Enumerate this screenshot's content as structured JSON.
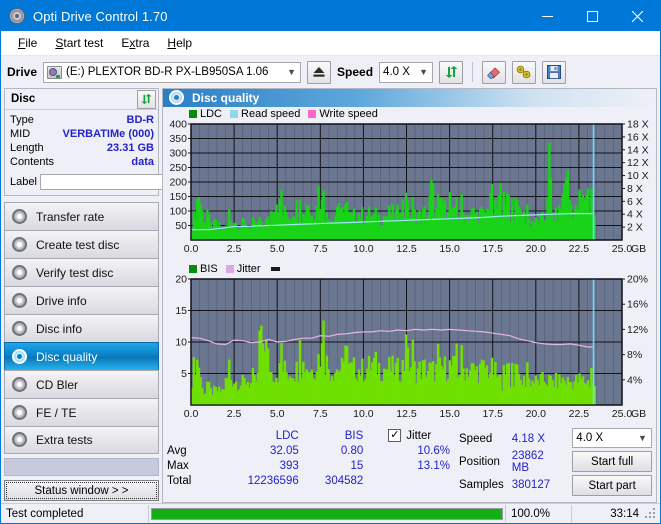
{
  "window": {
    "title": "Opti Drive Control 1.70",
    "icon": "disc-icon",
    "minimize": "minimize-icon",
    "maximize": "maximize-icon",
    "close": "close-icon"
  },
  "menu": [
    {
      "label": "File",
      "accel": "F"
    },
    {
      "label": "Start test",
      "accel": "S"
    },
    {
      "label": "Extra",
      "accel": "x"
    },
    {
      "label": "Help",
      "accel": "H"
    }
  ],
  "drivebar": {
    "drive_label": "Drive",
    "drive_value": "(E:)   PLEXTOR BD-R  PX-LB950SA 1.06",
    "eject_icon": "eject-icon",
    "speed_label": "Speed",
    "speed_value": "4.0 X",
    "refresh_icon": "refresh-icon",
    "erase_icon": "eraser-icon",
    "tools_icon": "plug-icon",
    "save_icon": "floppy-save-icon"
  },
  "disc_panel": {
    "title": "Disc",
    "refresh_icon": "refresh-icon",
    "rows": [
      {
        "key": "Type",
        "value": "BD-R"
      },
      {
        "key": "MID",
        "value": "VERBATIMe (000)"
      },
      {
        "key": "Length",
        "value": "23.31 GB"
      },
      {
        "key": "Contents",
        "value": "data"
      }
    ],
    "label_key": "Label",
    "label_value": "",
    "label_placeholder": "",
    "label_icon": "disc-gold-icon"
  },
  "nav": {
    "items": [
      {
        "label": "Transfer rate",
        "active": false
      },
      {
        "label": "Create test disc",
        "active": false
      },
      {
        "label": "Verify test disc",
        "active": false
      },
      {
        "label": "Drive info",
        "active": false
      },
      {
        "label": "Disc info",
        "active": false
      },
      {
        "label": "Disc quality",
        "active": true
      },
      {
        "label": "CD Bler",
        "active": false
      },
      {
        "label": "FE / TE",
        "active": false
      },
      {
        "label": "Extra tests",
        "active": false
      }
    ],
    "status_window_button": "Status window > >"
  },
  "content": {
    "header_title": "Disc quality",
    "header_icon": "disc-quality-icon"
  },
  "chart_data": [
    {
      "type": "area",
      "name": "ldc-chart",
      "title": "",
      "xlabel": "GB",
      "ylabel": "",
      "xlim": [
        0.0,
        25.0
      ],
      "xticks": [
        "0.0",
        "2.5",
        "5.0",
        "7.5",
        "10.0",
        "12.5",
        "15.0",
        "17.5",
        "20.0",
        "22.5",
        "25.0"
      ],
      "x_unit": "GB",
      "ylim": [
        0,
        400
      ],
      "yticks": [
        "50",
        "100",
        "150",
        "200",
        "250",
        "300",
        "350",
        "400"
      ],
      "y2lim": [
        0,
        18
      ],
      "y2ticks": [
        "2 X",
        "4 X",
        "6 X",
        "8 X",
        "10 X",
        "12 X",
        "14 X",
        "16 X",
        "18 X"
      ],
      "grid": true,
      "legend": [
        {
          "label": "LDC",
          "color": "#0a8a0a"
        },
        {
          "label": "Read speed",
          "color": "#8fd8f2"
        },
        {
          "label": "Write speed",
          "color": "#ff66cc"
        }
      ],
      "series": [
        {
          "name": "LDC",
          "color": "#18d318",
          "kind": "area",
          "x": [
            0.0,
            0.2,
            0.4,
            0.5,
            0.6,
            0.8,
            1.0,
            1.2,
            1.4,
            1.6,
            1.8,
            2.0,
            2.2,
            2.4,
            2.5,
            2.7,
            2.9,
            3.1,
            3.3,
            3.5,
            3.7,
            3.9,
            4.1,
            4.3,
            4.5,
            4.7,
            4.9,
            5.0,
            5.1,
            5.3,
            5.5,
            5.7,
            5.9,
            6.1,
            6.3,
            6.5,
            6.7,
            6.9,
            7.1,
            7.3,
            7.5,
            7.7,
            7.9,
            8.1,
            8.3,
            8.5,
            8.7,
            8.9,
            9.1,
            9.3,
            9.5,
            9.7,
            9.9,
            10.1,
            10.3,
            10.5,
            10.7,
            10.9,
            11.1,
            11.3,
            11.5,
            11.7,
            11.9,
            12.1,
            12.3,
            12.5,
            12.7,
            12.9,
            13.1,
            13.3,
            13.5,
            13.7,
            13.9,
            14.1,
            14.3,
            14.5,
            14.7,
            14.9,
            15.1,
            15.3,
            15.5,
            15.7,
            15.9,
            16.1,
            16.3,
            16.5,
            16.7,
            16.9,
            17.1,
            17.3,
            17.5,
            17.7,
            17.9,
            18.1,
            18.3,
            18.5,
            18.7,
            18.9,
            19.1,
            19.3,
            19.5,
            19.7,
            19.9,
            20.1,
            20.3,
            20.5,
            20.7,
            20.9,
            21.1,
            21.3,
            21.5,
            21.7,
            21.9,
            22.1,
            22.3,
            22.5,
            22.7,
            22.9,
            23.1,
            23.3
          ],
          "values": [
            60,
            150,
            230,
            175,
            120,
            95,
            70,
            65,
            80,
            60,
            55,
            58,
            95,
            100,
            85,
            70,
            75,
            90,
            60,
            62,
            78,
            65,
            70,
            88,
            95,
            185,
            200,
            180,
            150,
            120,
            140,
            110,
            160,
            150,
            100,
            120,
            205,
            110,
            130,
            250,
            170,
            120,
            105,
            110,
            125,
            195,
            115,
            100,
            112,
            108,
            120,
            130,
            115,
            110,
            125,
            105,
            118,
            108,
            112,
            115,
            130,
            120,
            115,
            210,
            125,
            140,
            115,
            120,
            118,
            110,
            130,
            125,
            255,
            135,
            125,
            200,
            130,
            220,
            120,
            115,
            130,
            125,
            118,
            122,
            130,
            120,
            128,
            118,
            135,
            250,
            130,
            155,
            225,
            120,
            130,
            115,
            120,
            110,
            140,
            105,
            95,
            90,
            85,
            88,
            100,
            92,
            390,
            120,
            110,
            130,
            200,
            360,
            180,
            150,
            130,
            200,
            180,
            260,
            150,
            120
          ]
        },
        {
          "name": "Read speed",
          "color": "#9fe8fa",
          "kind": "line",
          "x": [
            0.0,
            1.0,
            2.0,
            2.5,
            3.0,
            4.0,
            5.0,
            6.0,
            7.0,
            8.0,
            9.0,
            10.0,
            11.0,
            12.0,
            13.0,
            14.0,
            15.0,
            16.0,
            17.0,
            18.0,
            19.0,
            20.0,
            21.0,
            22.0,
            23.0,
            23.3
          ],
          "values": [
            1.6,
            1.6,
            1.9,
            2.1,
            2.1,
            2.2,
            2.3,
            2.4,
            2.5,
            2.6,
            2.7,
            2.8,
            2.9,
            3.0,
            3.1,
            3.2,
            3.3,
            3.4,
            3.5,
            3.7,
            3.8,
            3.9,
            4.0,
            4.1,
            4.1,
            4.1
          ]
        }
      ],
      "cursor_x": 23.35
    },
    {
      "type": "area",
      "name": "bis-jitter-chart",
      "title": "",
      "xlabel": "GB",
      "xlim": [
        0.0,
        25.0
      ],
      "xticks": [
        "0.0",
        "2.5",
        "5.0",
        "7.5",
        "10.0",
        "12.5",
        "15.0",
        "17.5",
        "20.0",
        "22.5",
        "25.0"
      ],
      "x_unit": "GB",
      "ylim": [
        0,
        20
      ],
      "yticks": [
        "5",
        "10",
        "15",
        "20"
      ],
      "y2lim": [
        0,
        20
      ],
      "y2ticks": [
        "4%",
        "8%",
        "12%",
        "16%",
        "20%"
      ],
      "grid": true,
      "legend": [
        {
          "label": "BIS",
          "color": "#0a8a0a"
        },
        {
          "label": "Jitter",
          "color": "#e0a8e0"
        }
      ],
      "series": [
        {
          "name": "BIS",
          "color": "#6fe000",
          "kind": "area",
          "x": [
            0.0,
            0.2,
            0.4,
            0.6,
            0.8,
            1.0,
            1.2,
            1.4,
            1.6,
            1.8,
            2.0,
            2.2,
            2.4,
            2.6,
            2.8,
            3.0,
            3.2,
            3.4,
            3.6,
            3.8,
            4.0,
            4.2,
            4.4,
            4.6,
            4.8,
            5.0,
            5.2,
            5.4,
            5.6,
            5.8,
            6.0,
            6.5,
            7.0,
            7.5,
            8.0,
            8.5,
            9.0,
            9.5,
            10.0,
            10.5,
            11.0,
            11.5,
            12.0,
            12.5,
            13.0,
            13.5,
            14.0,
            14.5,
            15.0,
            15.5,
            16.0,
            16.5,
            17.0,
            17.5,
            17.8,
            18.0,
            18.5,
            19.0,
            19.5,
            20.0,
            20.5,
            21.0,
            21.5,
            22.0,
            22.5,
            23.0,
            23.3
          ],
          "values": [
            6.0,
            10.0,
            9.0,
            3.0,
            3.0,
            3.0,
            3.0,
            3.2,
            3.0,
            3.2,
            5.5,
            6.0,
            5.5,
            5.0,
            4.5,
            5.0,
            5.5,
            4.5,
            5.0,
            5.5,
            13.0,
            15.0,
            10.0,
            7.0,
            7.0,
            7.0,
            8.0,
            7.5,
            7.0,
            8.0,
            7.5,
            9.0,
            7.5,
            12.0,
            7.5,
            8.0,
            7.5,
            8.0,
            7.5,
            9.0,
            8.0,
            8.0,
            7.5,
            9.5,
            7.5,
            8.0,
            7.5,
            8.0,
            8.5,
            7.5,
            8.0,
            7.5,
            8.0,
            7.5,
            5.5,
            5.0,
            5.5,
            5.0,
            5.5,
            5.0,
            5.5,
            5.0,
            5.5,
            5.0,
            5.5,
            5.0,
            4.5
          ]
        },
        {
          "name": "Jitter",
          "color": "#e6b4e6",
          "kind": "line",
          "x": [
            0.0,
            0.5,
            1.0,
            1.5,
            2.0,
            2.5,
            3.0,
            3.5,
            4.0,
            4.5,
            5.0,
            5.5,
            6.0,
            6.5,
            7.0,
            7.5,
            8.0,
            8.5,
            9.0,
            9.5,
            10.0,
            10.5,
            11.0,
            11.5,
            12.0,
            12.5,
            13.0,
            13.5,
            14.0,
            14.5,
            15.0,
            15.5,
            16.0,
            16.5,
            17.0,
            17.5,
            18.0,
            18.5,
            19.0,
            19.5,
            20.0,
            20.5,
            21.0,
            21.5,
            22.0,
            22.5,
            23.0,
            23.3
          ],
          "values": [
            10.7,
            10.6,
            10.2,
            9.7,
            9.6,
            10.3,
            10.2,
            9.9,
            10.0,
            10.4,
            10.0,
            10.1,
            10.4,
            10.6,
            10.6,
            11.0,
            10.9,
            11.2,
            11.3,
            11.5,
            11.6,
            11.6,
            11.8,
            11.7,
            11.9,
            11.8,
            12.0,
            11.9,
            12.0,
            11.9,
            12.0,
            11.9,
            11.8,
            11.7,
            11.6,
            11.4,
            11.2,
            11.0,
            10.5,
            10.2,
            9.9,
            9.7,
            9.6,
            9.6,
            9.7,
            9.5,
            9.2,
            9.2
          ]
        }
      ],
      "cursor_x": 23.35
    }
  ],
  "stats": {
    "columns": [
      "LDC",
      "BIS"
    ],
    "jitter_label": "Jitter",
    "jitter_checked": true,
    "rows": [
      {
        "key": "Avg",
        "ldc": "32.05",
        "bis": "0.80",
        "jitter": "10.6%"
      },
      {
        "key": "Max",
        "ldc": "393",
        "bis": "15",
        "jitter": "13.1%"
      },
      {
        "key": "Total",
        "ldc": "12236596",
        "bis": "304582",
        "jitter": ""
      }
    ],
    "speed_key": "Speed",
    "speed_value": "4.18 X",
    "position_key": "Position",
    "position_value": "23862 MB",
    "samples_key": "Samples",
    "samples_value": "380127",
    "speed_select": "4.0 X",
    "start_full": "Start full",
    "start_part": "Start part"
  },
  "statusbar": {
    "message": "Test completed",
    "progress_percent": "100.0%",
    "progress_value": 100,
    "elapsed": "33:14"
  },
  "colors": {
    "accent": "#0078d7",
    "value_blue": "#2323c8",
    "chart_bg": "#6b7690",
    "ldc_green": "#18d318",
    "bis_green": "#6fe000",
    "jitter_pink": "#e6b4e6",
    "read_speed_blue": "#9fe8fa",
    "progress_green": "#12b015"
  }
}
